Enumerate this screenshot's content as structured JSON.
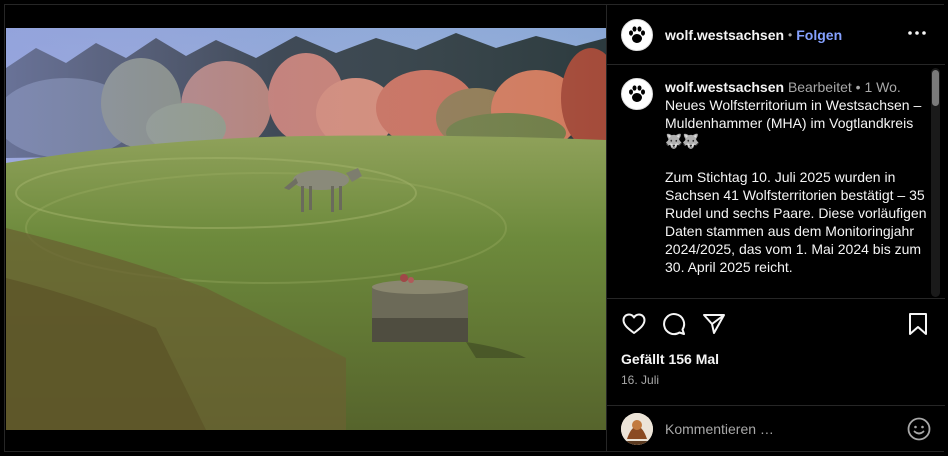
{
  "post": {
    "username": "wolf.westsachsen",
    "follow_label": "Folgen",
    "separator": "•"
  },
  "caption": {
    "username": "wolf.westsachsen",
    "edited_label": "Bearbeitet",
    "separator": "•",
    "age": "1 Wo.",
    "text": "Neues Wolfsterritorium in Westsachsen – Muldenhammer (MHA) im Vogtlandkreis 🐺🐺\n\nZum Stichtag 10. Juli 2025 wurden in Sachsen 41 Wolfsterritorien bestätigt – 35 Rudel und sechs Paare. Diese vorläufigen Daten stammen aus dem Monitoringjahr 2024/2025, das vom 1. Mai 2024 bis zum 30. April 2025 reicht."
  },
  "engagement": {
    "likes_text": "Gefällt 156 Mal",
    "date": "16. Juli"
  },
  "comment": {
    "placeholder": "Kommentieren …"
  },
  "icons": {
    "options": "more-horizontal-icon",
    "like": "heart-icon",
    "comment": "comment-bubble-icon",
    "share": "paper-plane-icon",
    "save": "bookmark-icon",
    "emoji": "smiley-icon"
  },
  "colors": {
    "background": "#000000",
    "follow": "#85a1ff",
    "secondary_text": "#a8a8a8",
    "divider": "#262626"
  }
}
